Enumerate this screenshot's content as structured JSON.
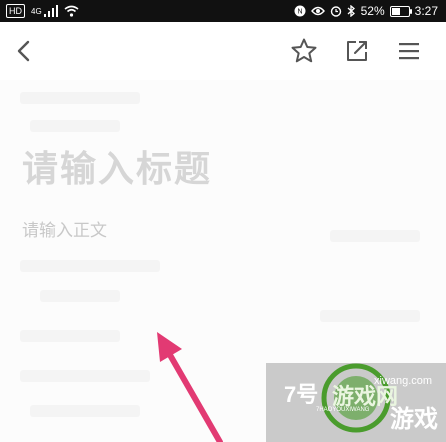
{
  "status_bar": {
    "chip_hd": "HD",
    "network": "4G",
    "battery": "52%",
    "battery_level": 0.52,
    "time": "3:27"
  },
  "editor": {
    "title_placeholder": "请输入标题",
    "body_placeholder": "请输入正文"
  },
  "watermark": {
    "brand_number": "7号",
    "brand_text": "游戏网",
    "pinyin": "7HAOYOUXIWANG",
    "url_fragment": "xiwang.com",
    "slogan": "游戏"
  },
  "colors": {
    "arrow": "#e23a73",
    "watermark_green": "#4a9c2d"
  },
  "icons": [
    "back-arrow-icon",
    "star-icon",
    "share-icon",
    "menu-icon"
  ]
}
